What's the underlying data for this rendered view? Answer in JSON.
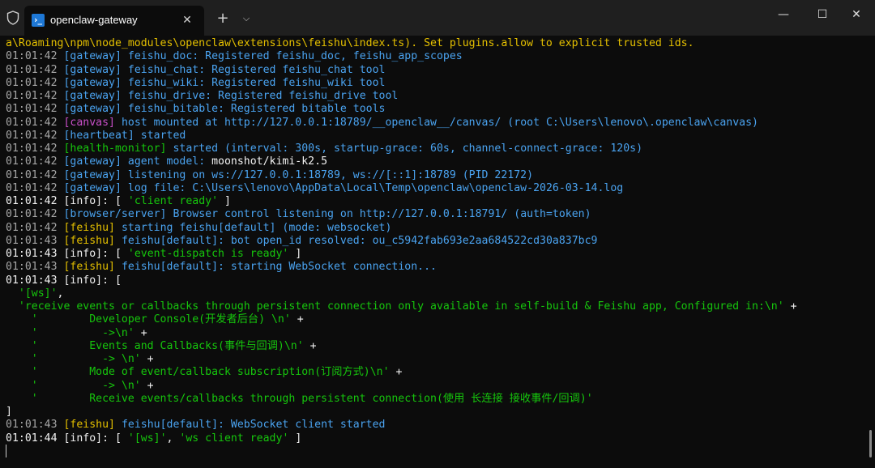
{
  "tab": {
    "title": "openclaw-gateway",
    "close": "✕",
    "new": "+",
    "dropdown": "⌵",
    "icon": "›_"
  },
  "window": {
    "minimize": "—",
    "maximize": "☐",
    "close": "✕"
  },
  "lines": [
    {
      "segs": [
        {
          "t": "a\\Roaming\\npm\\node_modules\\openclaw\\extensions\\feishu\\index.ts). Set plugins.allow to explicit trusted ids.",
          "c": "ylw"
        }
      ]
    },
    {
      "segs": [
        {
          "t": "01:01:42 ",
          "c": "ts"
        },
        {
          "t": "[gateway] ",
          "c": "gw"
        },
        {
          "t": "feishu_doc: Registered feishu_doc, feishu_app_scopes",
          "c": "msg"
        }
      ]
    },
    {
      "segs": [
        {
          "t": "01:01:42 ",
          "c": "ts"
        },
        {
          "t": "[gateway] ",
          "c": "gw"
        },
        {
          "t": "feishu_chat: Registered feishu_chat tool",
          "c": "msg"
        }
      ]
    },
    {
      "segs": [
        {
          "t": "01:01:42 ",
          "c": "ts"
        },
        {
          "t": "[gateway] ",
          "c": "gw"
        },
        {
          "t": "feishu_wiki: Registered feishu_wiki tool",
          "c": "msg"
        }
      ]
    },
    {
      "segs": [
        {
          "t": "01:01:42 ",
          "c": "ts"
        },
        {
          "t": "[gateway] ",
          "c": "gw"
        },
        {
          "t": "feishu_drive: Registered feishu_drive tool",
          "c": "msg"
        }
      ]
    },
    {
      "segs": [
        {
          "t": "01:01:42 ",
          "c": "ts"
        },
        {
          "t": "[gateway] ",
          "c": "gw"
        },
        {
          "t": "feishu_bitable: Registered bitable tools",
          "c": "msg"
        }
      ]
    },
    {
      "segs": [
        {
          "t": "01:01:42 ",
          "c": "ts"
        },
        {
          "t": "[canvas] ",
          "c": "cv"
        },
        {
          "t": "host mounted at http://127.0.0.1:18789/__openclaw__/canvas/ (root C:\\Users\\lenovo\\.openclaw\\canvas)",
          "c": "msg"
        }
      ]
    },
    {
      "segs": [
        {
          "t": "01:01:42 ",
          "c": "ts"
        },
        {
          "t": "[heartbeat] ",
          "c": "gw"
        },
        {
          "t": "started",
          "c": "msg"
        }
      ]
    },
    {
      "segs": [
        {
          "t": "01:01:42 ",
          "c": "ts"
        },
        {
          "t": "[health-monitor] ",
          "c": "hm"
        },
        {
          "t": "started (interval: 300s, startup-grace: 60s, channel-connect-grace: 120s)",
          "c": "msg"
        }
      ]
    },
    {
      "segs": [
        {
          "t": "01:01:42 ",
          "c": "ts"
        },
        {
          "t": "[gateway] ",
          "c": "gw"
        },
        {
          "t": "agent model: ",
          "c": "msg"
        },
        {
          "t": "moonshot/kimi-k2.5",
          "c": "wh"
        }
      ]
    },
    {
      "segs": [
        {
          "t": "01:01:42 ",
          "c": "ts"
        },
        {
          "t": "[gateway] ",
          "c": "gw"
        },
        {
          "t": "listening on ws://127.0.0.1:18789, ws://[::1]:18789 (PID 22172)",
          "c": "msg"
        }
      ]
    },
    {
      "segs": [
        {
          "t": "01:01:42 ",
          "c": "ts"
        },
        {
          "t": "[gateway] ",
          "c": "gw"
        },
        {
          "t": "log file: C:\\Users\\lenovo\\AppData\\Local\\Temp\\openclaw\\openclaw-2026-03-14.log",
          "c": "msg"
        }
      ]
    },
    {
      "segs": [
        {
          "t": "01:01:42 ",
          "c": "tsb"
        },
        {
          "t": "[info]: [ ",
          "c": "wh"
        },
        {
          "t": "'client ready'",
          "c": "gr"
        },
        {
          "t": " ]",
          "c": "wh"
        }
      ]
    },
    {
      "segs": [
        {
          "t": "01:01:42 ",
          "c": "ts"
        },
        {
          "t": "[browser/server] ",
          "c": "gw"
        },
        {
          "t": "Browser control listening on http://127.0.0.1:18791/ (auth=token)",
          "c": "msg"
        }
      ]
    },
    {
      "segs": [
        {
          "t": "01:01:42 ",
          "c": "ts"
        },
        {
          "t": "[feishu] ",
          "c": "fs"
        },
        {
          "t": "starting feishu[default] (mode: websocket)",
          "c": "msg"
        }
      ]
    },
    {
      "segs": [
        {
          "t": "01:01:43 ",
          "c": "ts"
        },
        {
          "t": "[feishu] ",
          "c": "fs"
        },
        {
          "t": "feishu[default]: bot open_id resolved: ou_c5942fab693e2aa684522cd30a837bc9",
          "c": "msg"
        }
      ]
    },
    {
      "segs": [
        {
          "t": "01:01:43 ",
          "c": "tsb"
        },
        {
          "t": "[info]: [ ",
          "c": "wh"
        },
        {
          "t": "'event-dispatch is ready'",
          "c": "gr"
        },
        {
          "t": " ]",
          "c": "wh"
        }
      ]
    },
    {
      "segs": [
        {
          "t": "01:01:43 ",
          "c": "ts"
        },
        {
          "t": "[feishu] ",
          "c": "fs"
        },
        {
          "t": "feishu[default]: starting WebSocket connection...",
          "c": "msg"
        }
      ]
    },
    {
      "segs": [
        {
          "t": "01:01:43 ",
          "c": "tsb"
        },
        {
          "t": "[info]: [",
          "c": "wh"
        }
      ]
    },
    {
      "segs": [
        {
          "t": "  '[ws]'",
          "c": "gr"
        },
        {
          "t": ",",
          "c": "wh"
        }
      ]
    },
    {
      "segs": [
        {
          "t": "  'receive events or callbacks through persistent connection only available in self-build & Feishu app, Configured in:\\n'",
          "c": "gr"
        },
        {
          "t": " +",
          "c": "wh"
        }
      ]
    },
    {
      "segs": [
        {
          "t": "    '        Developer Console(开发者后台) \\n'",
          "c": "gr"
        },
        {
          "t": " +",
          "c": "wh"
        }
      ]
    },
    {
      "segs": [
        {
          "t": "    '          ->\\n'",
          "c": "gr"
        },
        {
          "t": " +",
          "c": "wh"
        }
      ]
    },
    {
      "segs": [
        {
          "t": "    '        Events and Callbacks(事件与回调)\\n'",
          "c": "gr"
        },
        {
          "t": " +",
          "c": "wh"
        }
      ]
    },
    {
      "segs": [
        {
          "t": "    '          -> \\n'",
          "c": "gr"
        },
        {
          "t": " +",
          "c": "wh"
        }
      ]
    },
    {
      "segs": [
        {
          "t": "    '        Mode of event/callback subscription(订阅方式)\\n'",
          "c": "gr"
        },
        {
          "t": " +",
          "c": "wh"
        }
      ]
    },
    {
      "segs": [
        {
          "t": "    '          -> \\n'",
          "c": "gr"
        },
        {
          "t": " +",
          "c": "wh"
        }
      ]
    },
    {
      "segs": [
        {
          "t": "    '        Receive events/callbacks through persistent connection(使用 长连接 接收事件/回调)'",
          "c": "gr"
        }
      ]
    },
    {
      "segs": [
        {
          "t": "]",
          "c": "wh"
        }
      ]
    },
    {
      "segs": [
        {
          "t": "01:01:43 ",
          "c": "ts"
        },
        {
          "t": "[feishu] ",
          "c": "fs"
        },
        {
          "t": "feishu[default]: WebSocket client started",
          "c": "msg"
        }
      ]
    },
    {
      "segs": [
        {
          "t": "01:01:44 ",
          "c": "tsb"
        },
        {
          "t": "[info]: [ ",
          "c": "wh"
        },
        {
          "t": "'[ws]'",
          "c": "gr"
        },
        {
          "t": ", ",
          "c": "wh"
        },
        {
          "t": "'ws client ready'",
          "c": "gr"
        },
        {
          "t": " ]",
          "c": "wh"
        }
      ]
    }
  ]
}
